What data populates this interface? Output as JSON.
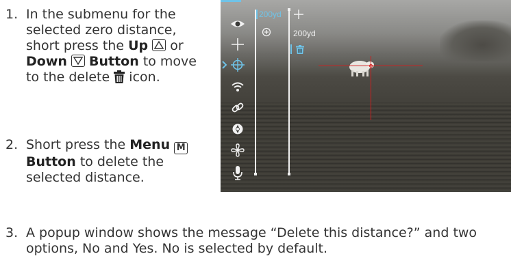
{
  "steps": [
    {
      "num": "1.",
      "parts": {
        "a": "In the submenu for the selected zero distance, short press the",
        "up": "Up",
        "or": "or",
        "down": "Down",
        "button": "Button",
        "b": "to move to the delete",
        "c": "icon."
      }
    },
    {
      "num": "2.",
      "parts": {
        "a": "Short press the",
        "menu": "Menu",
        "menu_key": "M",
        "button": "Button",
        "b": "to delete the selected distance."
      }
    },
    {
      "num": "3.",
      "text": "A popup window shows the message “Delete this distance?” and two options, No and Yes. No is selected by default."
    }
  ],
  "screen": {
    "distance_selected": "200yd",
    "distance_list_item": "200yd",
    "sidebar_icons": [
      "eye-icon",
      "crosshair-icon",
      "zero-target-icon",
      "wifi-icon",
      "link-icon",
      "aperture-icon",
      "fan-icon",
      "microphone-icon"
    ],
    "accent_color": "#6fc3e8",
    "reticle_color": "#d21d1d"
  }
}
